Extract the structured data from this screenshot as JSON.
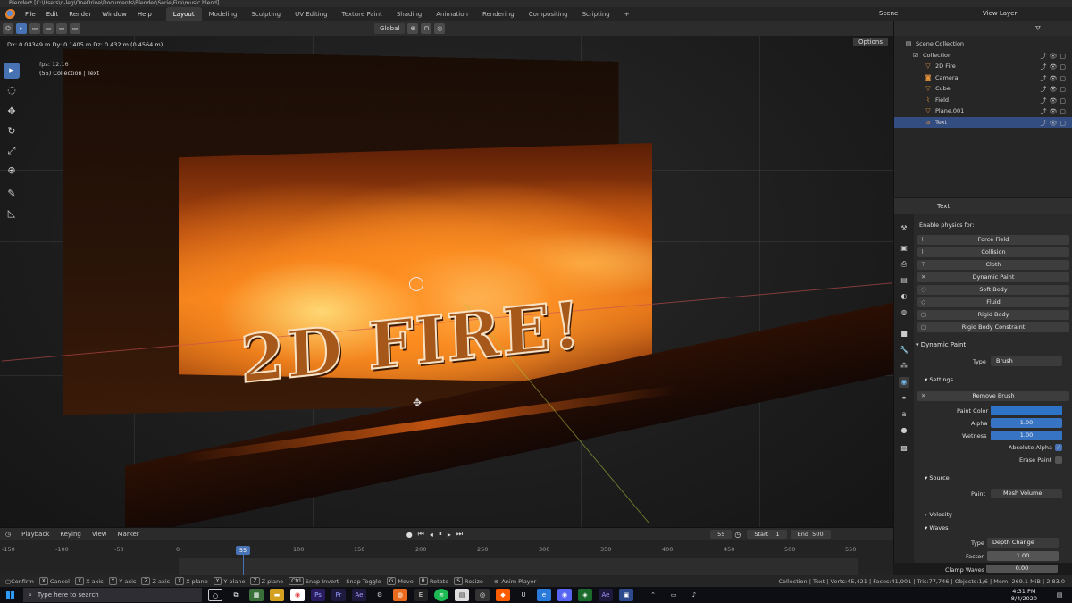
{
  "window": {
    "title": "Blender* [C:\\Users\\d-leg\\OneDrive\\Documents\\Blender\\Serie\\Fire\\music.blend]"
  },
  "menubar": {
    "menus": [
      "File",
      "Edit",
      "Render",
      "Window",
      "Help"
    ],
    "workspaces": [
      "Layout",
      "Modeling",
      "Sculpting",
      "UV Editing",
      "Texture Paint",
      "Shading",
      "Animation",
      "Rendering",
      "Compositing",
      "Scripting"
    ],
    "active_workspace": "Layout",
    "add_tab": "+",
    "scene": "Scene",
    "view_layer": "View Layer"
  },
  "toolbar": {
    "transform_orientation": "Global",
    "options": "Options"
  },
  "viewport": {
    "drag_readout": "Dx: 0.04349 m  Dy: 0.1405 m  Dz: 0.432 m (0.4564 m)",
    "fps": "fps: 12.16",
    "collection_info": "(55) Collection | Text",
    "fire_text": "2D FIRE!"
  },
  "outliner": {
    "root": "Scene Collection",
    "collection": "Collection",
    "items": [
      {
        "name": "2D Fire",
        "icon": "mesh-icon",
        "selected": false
      },
      {
        "name": "Camera",
        "icon": "camera-icon",
        "selected": false
      },
      {
        "name": "Cube",
        "icon": "mesh-icon",
        "selected": false
      },
      {
        "name": "Field",
        "icon": "force-field-icon",
        "selected": false
      },
      {
        "name": "Plane.001",
        "icon": "mesh-icon",
        "selected": false
      },
      {
        "name": "Text",
        "icon": "text-icon",
        "selected": true
      }
    ]
  },
  "properties": {
    "object_name": "Text",
    "enable_physics_label": "Enable physics for:",
    "physics_buttons": [
      "Force Field",
      "Collision",
      "Cloth",
      "Dynamic Paint",
      "Soft Body",
      "Fluid",
      "Rigid Body",
      "Rigid Body Constraint"
    ],
    "dynamic_paint": {
      "title": "Dynamic Paint",
      "type_label": "Type",
      "type_value": "Brush",
      "settings": "Settings",
      "remove_brush": "Remove Brush",
      "paint_color_label": "Paint Color",
      "paint_color": "#2d74c8",
      "alpha_label": "Alpha",
      "alpha_value": "1.00",
      "wetness_label": "Wetness",
      "wetness_value": "1.00",
      "absolute_alpha_label": "Absolute Alpha",
      "erase_paint_label": "Erase Paint",
      "source": "Source",
      "paint_label": "Paint",
      "paint_value": "Mesh Volume",
      "velocity": "Velocity",
      "waves": "Waves",
      "waves_type_label": "Type",
      "waves_type_value": "Depth Change",
      "factor_label": "Factor",
      "factor_value": "1.00",
      "clamp_waves_label": "Clamp Waves",
      "clamp_waves_value": "0.00"
    }
  },
  "timeline": {
    "menus": [
      "Playback",
      "Keying",
      "View",
      "Marker"
    ],
    "current_frame": "55",
    "start_label": "Start",
    "start_value": "1",
    "end_label": "End",
    "end_value": "500",
    "ruler_ticks": [
      "-150",
      "-100",
      "-50",
      "0",
      "100",
      "150",
      "200",
      "250",
      "300",
      "350",
      "400",
      "450",
      "500",
      "550"
    ]
  },
  "statusbar": {
    "items": [
      {
        "key": "",
        "label": "Confirm"
      },
      {
        "key": "X",
        "label": "Cancel"
      },
      {
        "key": "X",
        "label": "X axis"
      },
      {
        "key": "Y",
        "label": "Y axis"
      },
      {
        "key": "Z",
        "label": "Z axis"
      },
      {
        "key": "X",
        "label": "X plane"
      },
      {
        "key": "Y",
        "label": "Y plane"
      },
      {
        "key": "Z",
        "label": "Z plane"
      },
      {
        "key": "Ctrl",
        "label": "Snap Invert"
      },
      {
        "key": "",
        "label": "Snap Toggle"
      },
      {
        "key": "G",
        "label": "Move"
      },
      {
        "key": "R",
        "label": "Rotate"
      },
      {
        "key": "S",
        "label": "Resize"
      },
      {
        "key": "",
        "label": "Anim Player"
      }
    ],
    "stats": "Collection | Text | Verts:45,421 | Faces:41,901 | Tris:77,746 | Objects:1/6 | Mem: 269.1 MiB | 2.83.0"
  },
  "taskbar": {
    "search_placeholder": "Type here to search",
    "time": "4:31 PM",
    "date": "8/4/2020"
  }
}
